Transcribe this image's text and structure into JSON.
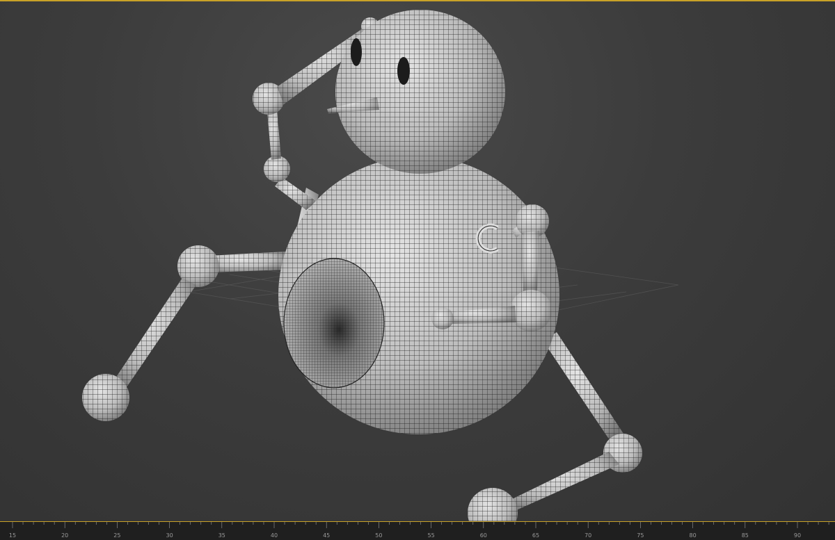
{
  "app": {
    "accent_color": "#c9a227",
    "viewport_background": "#3c3c3c"
  },
  "scene": {
    "object_type": "wireframe-snowman-robot",
    "wire_color": "#111111",
    "mesh_fill_color": "#cfcfcf"
  },
  "timeline": {
    "ticks": [
      "15",
      "20",
      "25",
      "30",
      "35",
      "40",
      "45",
      "50",
      "55",
      "60",
      "65",
      "70",
      "75",
      "80",
      "85",
      "90"
    ]
  }
}
